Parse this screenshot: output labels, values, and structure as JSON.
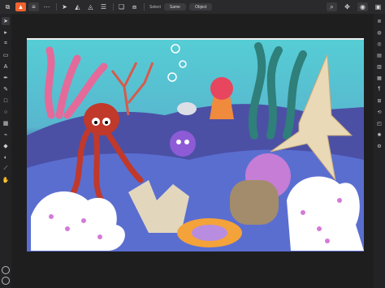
{
  "toolbar": {
    "select_label": "Select",
    "same_label": "Same",
    "object_label": "Object"
  },
  "colors": {
    "accent": "#f0622f",
    "ui_dark": "#1e1e1e",
    "sea_top": "#4fc7d0",
    "sea_mid": "#4b55a6",
    "sand_blue": "#5b6fcf"
  },
  "icons": {
    "menu": "hamburger-icon",
    "more": "ellipsis-icon",
    "move": "cursor-icon",
    "zoom": "search-icon",
    "view": "eye-icon",
    "camera": "camera-icon"
  }
}
